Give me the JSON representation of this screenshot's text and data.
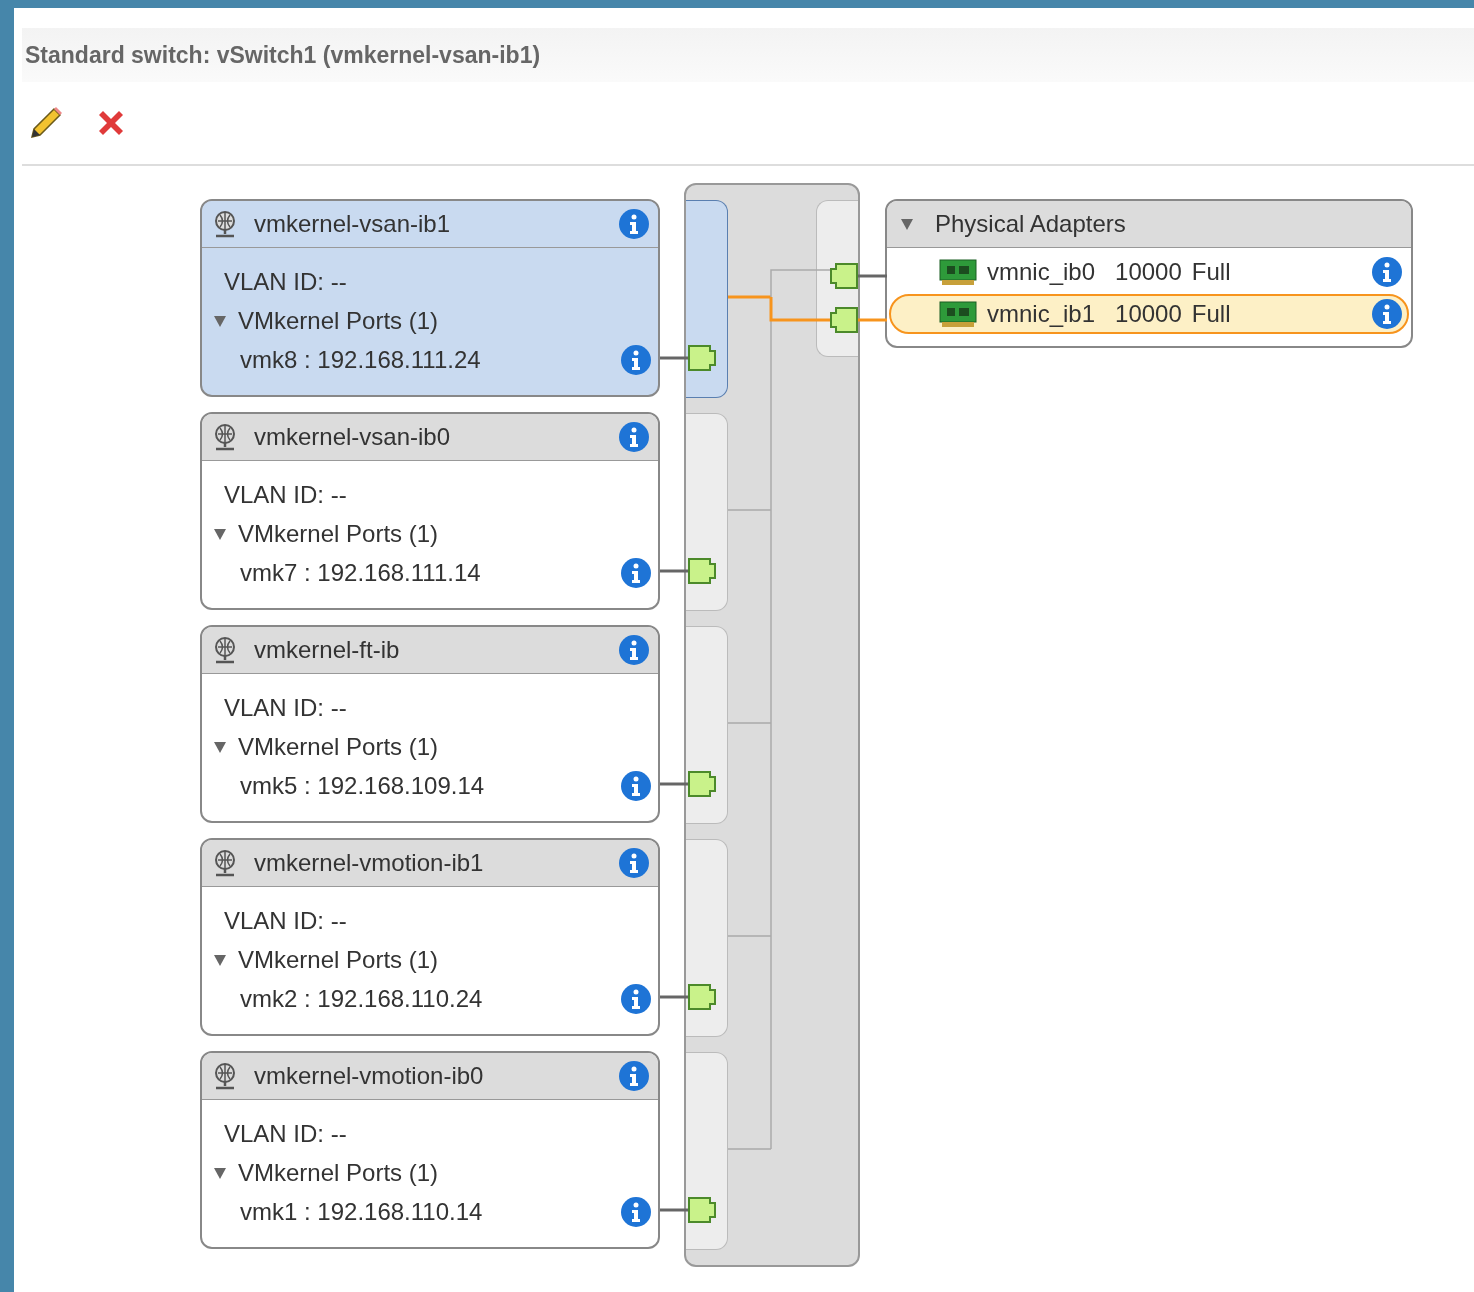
{
  "title": "Standard switch: vSwitch1 (vmkernel-vsan-ib1)",
  "port_groups": [
    {
      "name": "vmkernel-vsan-ib1",
      "selected": true,
      "vlan": "VLAN ID: --",
      "ports_label": "VMkernel Ports (1)",
      "expanded": true,
      "ports": [
        "vmk8 : 192.168.111.24"
      ]
    },
    {
      "name": "vmkernel-vsan-ib0",
      "selected": false,
      "vlan": "VLAN ID: --",
      "ports_label": "VMkernel Ports (1)",
      "expanded": true,
      "ports": [
        "vmk7 : 192.168.111.14"
      ]
    },
    {
      "name": "vmkernel-ft-ib",
      "selected": false,
      "vlan": "VLAN ID: --",
      "ports_label": "VMkernel Ports (1)",
      "expanded": true,
      "ports": [
        "vmk5 : 192.168.109.14"
      ]
    },
    {
      "name": "vmkernel-vmotion-ib1",
      "selected": false,
      "vlan": "VLAN ID: --",
      "ports_label": "VMkernel Ports (1)",
      "expanded": true,
      "ports": [
        "vmk2 : 192.168.110.24"
      ]
    },
    {
      "name": "vmkernel-vmotion-ib0",
      "selected": false,
      "vlan": "VLAN ID: --",
      "ports_label": "VMkernel Ports (1)",
      "expanded": true,
      "ports": [
        "vmk1 : 192.168.110.14"
      ]
    }
  ],
  "physical_adapters": {
    "label": "Physical Adapters",
    "expanded": true,
    "adapters": [
      {
        "name": "vmnic_ib0",
        "speed": "10000",
        "duplex": "Full",
        "selected": false
      },
      {
        "name": "vmnic_ib1",
        "speed": "10000",
        "duplex": "Full",
        "selected": true
      }
    ]
  }
}
